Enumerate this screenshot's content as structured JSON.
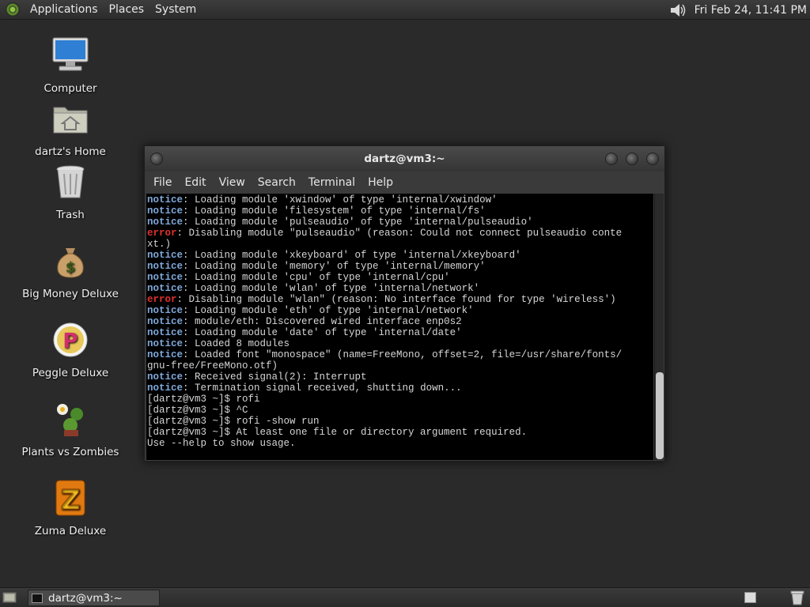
{
  "top_panel": {
    "menus": [
      "Applications",
      "Places",
      "System"
    ],
    "clock": "Fri Feb 24, 11:41 PM"
  },
  "desktop_icons": [
    {
      "label": "Computer",
      "icon": "computer-icon"
    },
    {
      "label": "dartz's Home",
      "icon": "home-folder-icon"
    },
    {
      "label": "Trash",
      "icon": "trash-icon"
    },
    {
      "label": "Big Money Deluxe",
      "icon": "money-bag-icon"
    },
    {
      "label": "Peggle Deluxe",
      "icon": "peggle-icon"
    },
    {
      "label": "Plants vs Zombies",
      "icon": "plants-vs-zombies-icon"
    },
    {
      "label": "Zuma Deluxe",
      "icon": "zuma-icon"
    }
  ],
  "window": {
    "title": "dartz@vm3:~",
    "menu": [
      "File",
      "Edit",
      "View",
      "Search",
      "Terminal",
      "Help"
    ],
    "lines": [
      {
        "level": "notice",
        "text": ": Loading module 'xwindow' of type 'internal/xwindow'"
      },
      {
        "level": "notice",
        "text": ": Loading module 'filesystem' of type 'internal/fs'"
      },
      {
        "level": "notice",
        "text": ": Loading module 'pulseaudio' of type 'internal/pulseaudio'"
      },
      {
        "level": "error",
        "text": ": Disabling module \"pulseaudio\" (reason: Could not connect pulseaudio conte"
      },
      {
        "level": "",
        "text": "xt.)"
      },
      {
        "level": "notice",
        "text": ": Loading module 'xkeyboard' of type 'internal/xkeyboard'"
      },
      {
        "level": "notice",
        "text": ": Loading module 'memory' of type 'internal/memory'"
      },
      {
        "level": "notice",
        "text": ": Loading module 'cpu' of type 'internal/cpu'"
      },
      {
        "level": "notice",
        "text": ": Loading module 'wlan' of type 'internal/network'"
      },
      {
        "level": "error",
        "text": ": Disabling module \"wlan\" (reason: No interface found for type 'wireless')"
      },
      {
        "level": "notice",
        "text": ": Loading module 'eth' of type 'internal/network'"
      },
      {
        "level": "notice",
        "text": ": module/eth: Discovered wired interface enp0s2"
      },
      {
        "level": "notice",
        "text": ": Loading module 'date' of type 'internal/date'"
      },
      {
        "level": "notice",
        "text": ": Loaded 8 modules"
      },
      {
        "level": "notice",
        "text": ": Loaded font \"monospace\" (name=FreeMono, offset=2, file=/usr/share/fonts/"
      },
      {
        "level": "",
        "text": "gnu-free/FreeMono.otf)"
      },
      {
        "level": "notice",
        "text": ": Received signal(2): Interrupt"
      },
      {
        "level": "notice",
        "text": ": Termination signal received, shutting down..."
      },
      {
        "level": "",
        "text": "[dartz@vm3 ~]$ rofi"
      },
      {
        "level": "",
        "text": "[dartz@vm3 ~]$ ^C"
      },
      {
        "level": "",
        "text": "[dartz@vm3 ~]$ rofi -show run"
      },
      {
        "level": "",
        "text": "[dartz@vm3 ~]$ At least one file or directory argument required."
      },
      {
        "level": "",
        "text": "Use --help to show usage."
      }
    ]
  },
  "taskbar": {
    "task_label": "dartz@vm3:~"
  }
}
